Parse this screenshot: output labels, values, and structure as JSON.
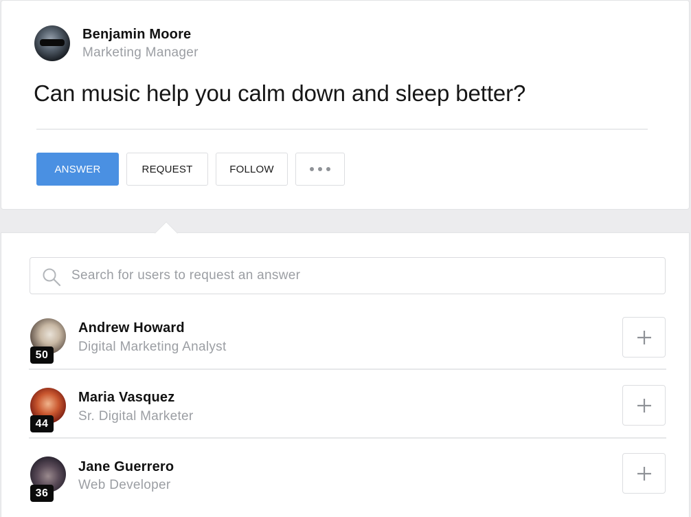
{
  "question_card": {
    "author": {
      "name": "Benjamin Moore",
      "role": "Marketing Manager"
    },
    "question": "Can music help you calm down and sleep better?",
    "actions": {
      "answer_label": "ANSWER",
      "request_label": "REQUEST",
      "follow_label": "FOLLOW",
      "more_icon": "more-horizontal-icon"
    }
  },
  "request_panel": {
    "search": {
      "placeholder": "Search for users to request an answer",
      "value": "",
      "icon": "search-icon"
    },
    "users": [
      {
        "name": "Andrew Howard",
        "role": "Digital Marketing Analyst",
        "score": "50"
      },
      {
        "name": "Maria Vasquez",
        "role": "Sr. Digital Marketer",
        "score": "44"
      },
      {
        "name": "Jane Guerrero",
        "role": "Web Developer",
        "score": "36"
      }
    ],
    "add_icon": "plus-icon"
  },
  "colors": {
    "accent": "#4a90e2",
    "muted_text": "#9b9ea3",
    "badge_bg": "#0b0b0b"
  }
}
